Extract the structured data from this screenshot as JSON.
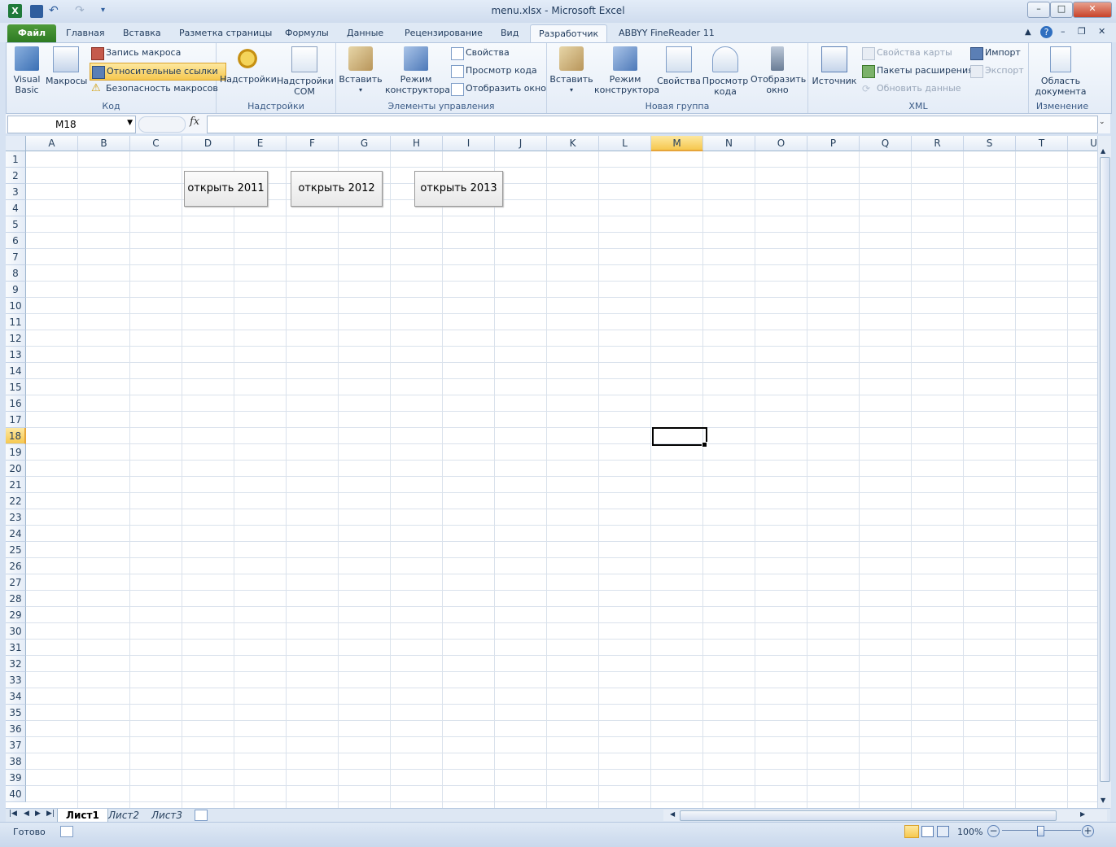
{
  "window": {
    "title": "menu.xlsx  -  Microsoft Excel",
    "minimize": "–",
    "maximize": "□",
    "close": "✕"
  },
  "tabs": [
    {
      "label": "Файл"
    },
    {
      "label": "Главная"
    },
    {
      "label": "Вставка"
    },
    {
      "label": "Разметка страницы"
    },
    {
      "label": "Формулы"
    },
    {
      "label": "Данные"
    },
    {
      "label": "Рецензирование"
    },
    {
      "label": "Вид"
    },
    {
      "label": "Разработчик"
    },
    {
      "label": "ABBYY FineReader 11"
    }
  ],
  "ribbon": {
    "code": {
      "label": "Код",
      "visual_basic": "Visual Basic",
      "macros": "Макросы",
      "record": "Запись макроса",
      "relative": "Относительные ссылки",
      "security": "Безопасность макросов"
    },
    "addins": {
      "label": "Надстройки",
      "addins": "Надстройки",
      "com": "Надстройки COM"
    },
    "controls": {
      "label": "Элементы управления",
      "insert": "Вставить",
      "design": "Режим конструктора",
      "properties": "Свойства",
      "view_code": "Просмотр кода",
      "dialog": "Отобразить окно"
    },
    "newgroup": {
      "label": "Новая группа",
      "insert": "Вставить",
      "design": "Режим конструктора",
      "properties": "Свойства",
      "view_code": "Просмотр кода",
      "show_window": "Отобразить окно"
    },
    "xml": {
      "label": "XML",
      "source": "Источник",
      "map_props": "Свойства карты",
      "expansion": "Пакеты расширения",
      "refresh": "Обновить данные",
      "import": "Импорт",
      "export": "Экспорт"
    },
    "modify": {
      "label": "Изменение",
      "doc_panel": "Область документа"
    }
  },
  "formula_bar": {
    "name_box": "M18",
    "fx": "fx",
    "formula": ""
  },
  "grid": {
    "columns": [
      "A",
      "B",
      "C",
      "D",
      "E",
      "F",
      "G",
      "H",
      "I",
      "J",
      "K",
      "L",
      "M",
      "N",
      "O",
      "P",
      "Q",
      "R",
      "S",
      "T",
      "U"
    ],
    "rows": [
      "1",
      "2",
      "3",
      "4",
      "5",
      "6",
      "7",
      "8",
      "9",
      "10",
      "11",
      "12",
      "13",
      "14",
      "15",
      "16",
      "17",
      "18",
      "19",
      "20",
      "21",
      "22",
      "23",
      "24",
      "25",
      "26",
      "27",
      "28",
      "29",
      "30",
      "31",
      "32",
      "33",
      "34",
      "35",
      "36",
      "37",
      "38",
      "39",
      "40"
    ],
    "selected_col": "M",
    "selected_row": "18",
    "buttons": [
      "открыть 2011",
      "открыть 2012",
      "открыть 2013"
    ]
  },
  "sheets": [
    "Лист1",
    "Лист2",
    "Лист3"
  ],
  "status": {
    "ready": "Готово",
    "zoom": "100%"
  }
}
